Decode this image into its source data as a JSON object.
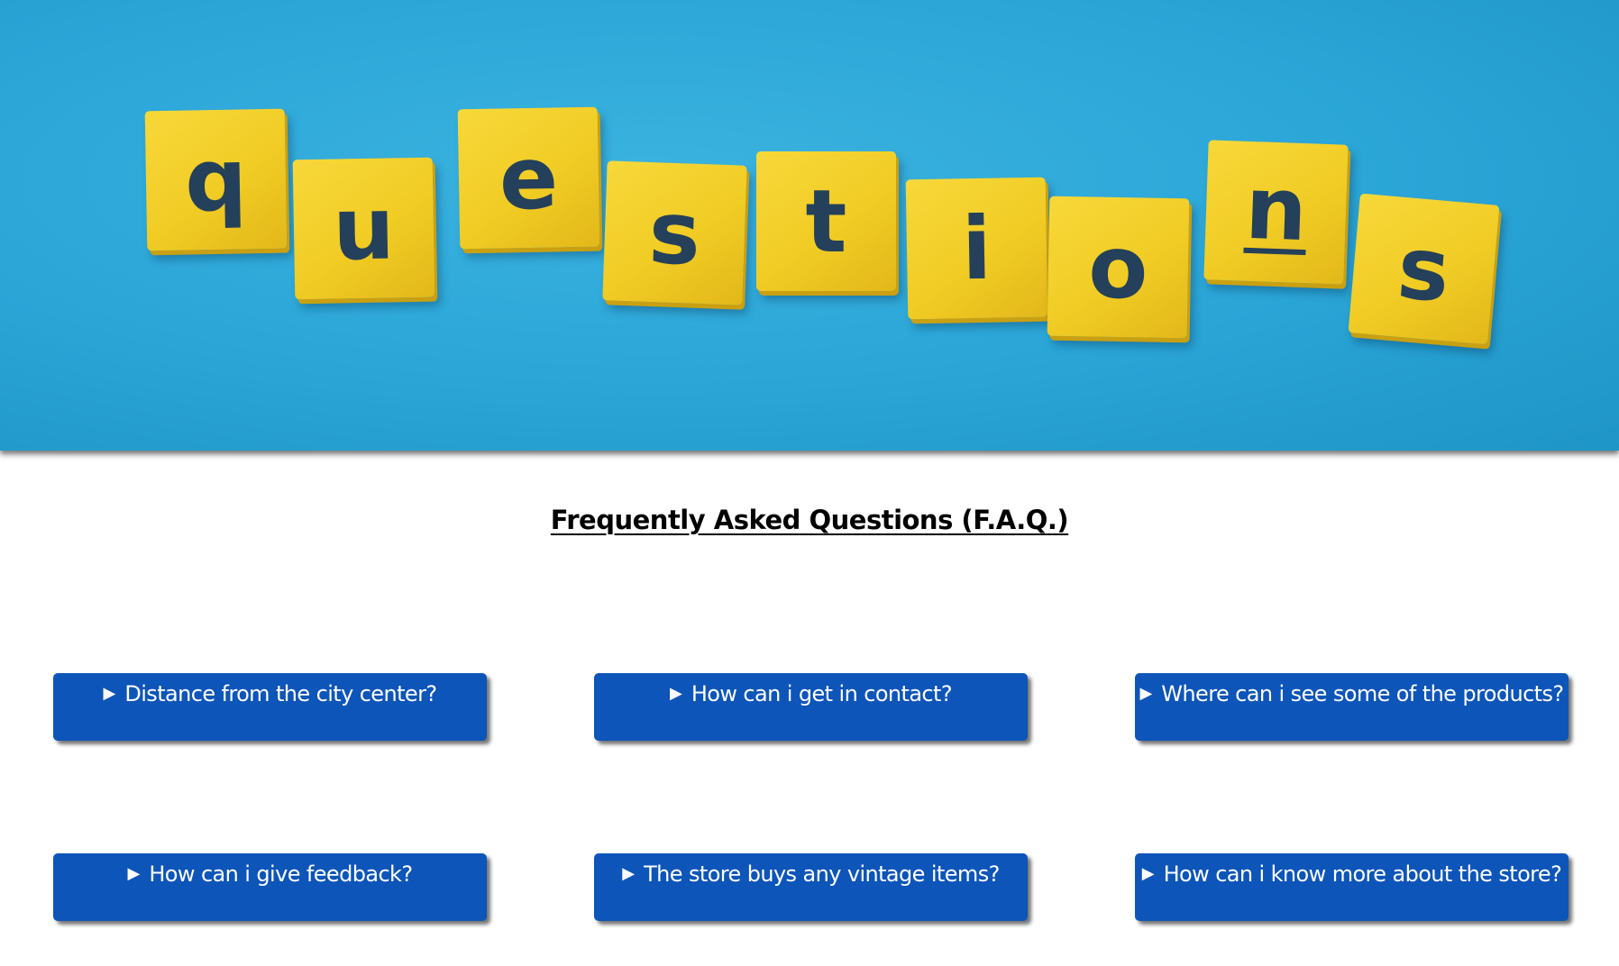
{
  "hero": {
    "tiles": [
      "q",
      "u",
      "e",
      "s",
      "t",
      "i",
      "o",
      "n",
      "s"
    ]
  },
  "faq": {
    "title": "Frequently Asked Questions (F.A.Q.)",
    "arrow_glyph": "▶",
    "items": [
      {
        "question": "Distance from the city center?"
      },
      {
        "question": "How can i get in contact?"
      },
      {
        "question": "Where can i see some of the products?"
      },
      {
        "question": "How can i give feedback?"
      },
      {
        "question": "The store buys any vintage items?"
      },
      {
        "question": "How can i know more about the store?"
      }
    ]
  },
  "colors": {
    "hero_background": "#2aa5d6",
    "tile_yellow": "#f1cc25",
    "tile_letter": "#24405a",
    "button_blue": "#0d55b8",
    "button_text": "#ffffff"
  }
}
